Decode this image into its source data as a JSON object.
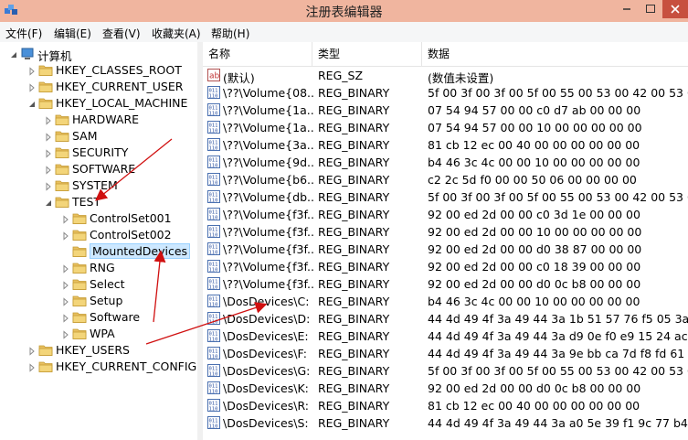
{
  "window": {
    "title": "注册表编辑器"
  },
  "menu": [
    "文件(F)",
    "编辑(E)",
    "查看(V)",
    "收藏夹(A)",
    "帮助(H)"
  ],
  "tree": {
    "root": "计算机",
    "hives_top": [
      "HKEY_CLASSES_ROOT",
      "HKEY_CURRENT_USER",
      "HKEY_LOCAL_MACHINE"
    ],
    "hklm_children": [
      "HARDWARE",
      "SAM",
      "SECURITY",
      "SOFTWARE",
      "SYSTEM",
      "TEST"
    ],
    "test_children": [
      "ControlSet001",
      "ControlSet002",
      "MountedDevices",
      "RNG",
      "Select",
      "Setup",
      "Software",
      "WPA"
    ],
    "selected": "MountedDevices",
    "hives_bottom": [
      "HKEY_USERS",
      "HKEY_CURRENT_CONFIG"
    ]
  },
  "columns": {
    "name": "名称",
    "type": "类型",
    "data": "数据"
  },
  "values": [
    {
      "icon": "string-value-icon",
      "name": "(默认)",
      "type": "REG_SZ",
      "data": "(数值未设置)"
    },
    {
      "icon": "binary-value-icon",
      "name": "\\??\\Volume{08...",
      "type": "REG_BINARY",
      "data": "5f 00 3f 00 3f 00 5f 00 55 00 53 00 42 00 53 0..."
    },
    {
      "icon": "binary-value-icon",
      "name": "\\??\\Volume{1a...",
      "type": "REG_BINARY",
      "data": "07 54 94 57 00 00 c0 d7 ab 00 00 00"
    },
    {
      "icon": "binary-value-icon",
      "name": "\\??\\Volume{1a...",
      "type": "REG_BINARY",
      "data": "07 54 94 57 00 00 10 00 00 00 00 00"
    },
    {
      "icon": "binary-value-icon",
      "name": "\\??\\Volume{3a...",
      "type": "REG_BINARY",
      "data": "81 cb 12 ec 00 40 00 00 00 00 00 00"
    },
    {
      "icon": "binary-value-icon",
      "name": "\\??\\Volume{9d...",
      "type": "REG_BINARY",
      "data": "b4 46 3c 4c 00 00 10 00 00 00 00 00"
    },
    {
      "icon": "binary-value-icon",
      "name": "\\??\\Volume{b6...",
      "type": "REG_BINARY",
      "data": "c2 2c 5d f0 00 00 50 06 00 00 00 00"
    },
    {
      "icon": "binary-value-icon",
      "name": "\\??\\Volume{db...",
      "type": "REG_BINARY",
      "data": "5f 00 3f 00 3f 00 5f 00 55 00 53 00 42 00 53 0..."
    },
    {
      "icon": "binary-value-icon",
      "name": "\\??\\Volume{f3f...",
      "type": "REG_BINARY",
      "data": "92 00 ed 2d 00 00 c0 3d 1e 00 00 00"
    },
    {
      "icon": "binary-value-icon",
      "name": "\\??\\Volume{f3f...",
      "type": "REG_BINARY",
      "data": "92 00 ed 2d 00 00 10 00 00 00 00 00"
    },
    {
      "icon": "binary-value-icon",
      "name": "\\??\\Volume{f3f...",
      "type": "REG_BINARY",
      "data": "92 00 ed 2d 00 00 d0 38 87 00 00 00"
    },
    {
      "icon": "binary-value-icon",
      "name": "\\??\\Volume{f3f...",
      "type": "REG_BINARY",
      "data": "92 00 ed 2d 00 00 c0 18 39 00 00 00"
    },
    {
      "icon": "binary-value-icon",
      "name": "\\??\\Volume{f3f...",
      "type": "REG_BINARY",
      "data": "92 00 ed 2d 00 00 d0 0c b8 00 00 00"
    },
    {
      "icon": "binary-value-icon",
      "name": "\\DosDevices\\C:",
      "type": "REG_BINARY",
      "data": "b4 46 3c 4c 00 00 10 00 00 00 00 00"
    },
    {
      "icon": "binary-value-icon",
      "name": "\\DosDevices\\D:",
      "type": "REG_BINARY",
      "data": "44 4d 49 4f 3a 49 44 3a 1b 51 57 76 f5 05 3a ..."
    },
    {
      "icon": "binary-value-icon",
      "name": "\\DosDevices\\E:",
      "type": "REG_BINARY",
      "data": "44 4d 49 4f 3a 49 44 3a d9 0e f0 e9 15 24 ac ..."
    },
    {
      "icon": "binary-value-icon",
      "name": "\\DosDevices\\F:",
      "type": "REG_BINARY",
      "data": "44 4d 49 4f 3a 49 44 3a 9e bb ca 7d f8 fd 61 ..."
    },
    {
      "icon": "binary-value-icon",
      "name": "\\DosDevices\\G:",
      "type": "REG_BINARY",
      "data": "5f 00 3f 00 3f 00 5f 00 55 00 53 00 42 00 53 0..."
    },
    {
      "icon": "binary-value-icon",
      "name": "\\DosDevices\\K:",
      "type": "REG_BINARY",
      "data": "92 00 ed 2d 00 00 d0 0c b8 00 00 00"
    },
    {
      "icon": "binary-value-icon",
      "name": "\\DosDevices\\R:",
      "type": "REG_BINARY",
      "data": "81 cb 12 ec 00 40 00 00 00 00 00 00"
    },
    {
      "icon": "binary-value-icon",
      "name": "\\DosDevices\\S:",
      "type": "REG_BINARY",
      "data": "44 4d 49 4f 3a 49 44 3a a0 5e 39 f1 9c 77 b4 ..."
    }
  ],
  "colors": {
    "titlebar": "#f0b59f",
    "close_button": "#c7503f",
    "selection": "#cde8ff",
    "annotation_arrow": "#d01010",
    "folder": "#e8c060"
  }
}
